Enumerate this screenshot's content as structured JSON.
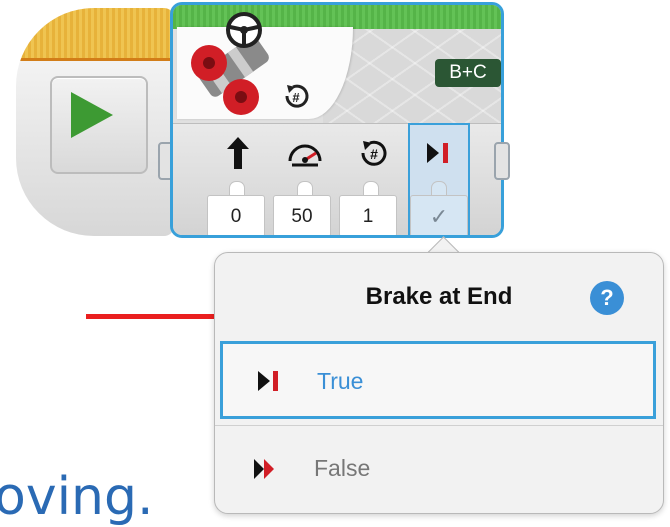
{
  "move_block": {
    "ports": "B+C",
    "inputs": [
      "0",
      "50",
      "1",
      "✓"
    ],
    "icons": [
      "steering-arrow-icon",
      "power-dial-icon",
      "rotations-icon",
      "brake-icon"
    ]
  },
  "popup": {
    "title": "Brake at End",
    "help": "?",
    "options": [
      {
        "label": "True",
        "icon": "brake-stop-icon",
        "selected": true
      },
      {
        "label": "False",
        "icon": "coast-icon",
        "selected": false
      }
    ]
  },
  "background_text": "oving.",
  "colors": {
    "selection_blue": "#3aa0da",
    "arrow_red": "#ea1f1f",
    "start_green": "#3d9a33",
    "port_green": "#2b5634"
  }
}
